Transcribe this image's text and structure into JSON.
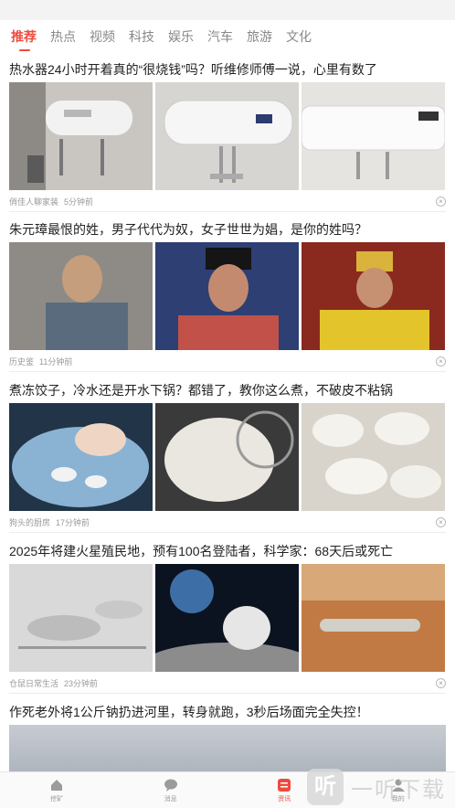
{
  "tabs": [
    "推荐",
    "热点",
    "视频",
    "科技",
    "娱乐",
    "汽车",
    "旅游",
    "文化"
  ],
  "articles": [
    {
      "title": "热水器24小时开着真的“很烧钱”吗？听维修师傅一说，心里有数了",
      "source": "俏佳人聊家装",
      "time": "5分钟前"
    },
    {
      "title": "朱元璋最恨的姓，男子代代为奴，女子世世为娼，是你的姓吗？",
      "source": "历史鉴",
      "time": "11分钟前"
    },
    {
      "title": "煮冻饺子，冷水还是开水下锅？都错了，教你这么煮，不破皮不粘锅",
      "source": "狗头的厨房",
      "time": "17分钟前"
    },
    {
      "title": "2025年将建火星殖民地，预有100名登陆者，科学家：68天后或死亡",
      "source": "仓鼠日常生活",
      "time": "23分钟前"
    },
    {
      "title": "作死老外将1公斤钠扔进河里，转身就跑，3秒后场面完全失控！"
    }
  ],
  "close_glyph": "×",
  "nav": [
    {
      "label": "挖矿",
      "icon": "home-icon"
    },
    {
      "label": "消息",
      "icon": "chat-icon"
    },
    {
      "label": "资讯",
      "icon": "news-icon"
    },
    {
      "label": "我的",
      "icon": "user-icon"
    }
  ],
  "watermark": {
    "logo": "听",
    "text": "一听下载"
  },
  "colors": {
    "accent": "#f04a3b",
    "muted": "#999999"
  }
}
